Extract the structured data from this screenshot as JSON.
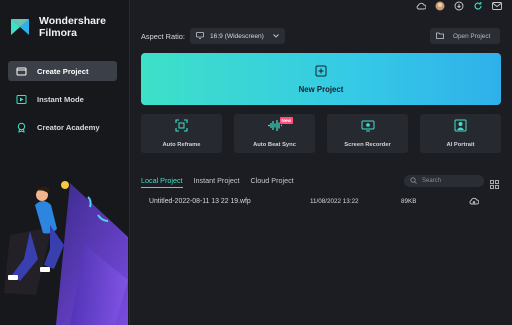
{
  "app": {
    "brand_line1": "Wondershare",
    "brand_line2": "Filmora"
  },
  "sidebar": {
    "items": [
      {
        "label": "Create Project",
        "icon": "folder-icon",
        "active": true
      },
      {
        "label": "Instant Mode",
        "icon": "instant-mode-icon",
        "active": false
      },
      {
        "label": "Creator Academy",
        "icon": "academy-icon",
        "active": false
      }
    ]
  },
  "topbar": {
    "icons": [
      "cloud-icon",
      "user-avatar-icon",
      "download-icon",
      "sync-icon",
      "mail-icon"
    ]
  },
  "aspect": {
    "label": "Aspect Ratio:",
    "value": "16:9 (Widescreen)"
  },
  "open_project": {
    "label": "Open Project"
  },
  "new_project": {
    "label": "New Project"
  },
  "tools": [
    {
      "label": "Auto Reframe",
      "icon": "auto-reframe-icon"
    },
    {
      "label": "Auto Beat Sync",
      "icon": "beat-sync-icon",
      "badge": "New"
    },
    {
      "label": "Screen Recorder",
      "icon": "screen-recorder-icon"
    },
    {
      "label": "AI Portrait",
      "icon": "ai-portrait-icon"
    }
  ],
  "tabs": [
    "Local Project",
    "Instant Project",
    "Cloud Project"
  ],
  "search": {
    "placeholder": "Search"
  },
  "projects": [
    {
      "name": "Untitled-2022-08-11 13 22 19.wfp",
      "date": "11/08/2022 13:22",
      "size": "89KB"
    }
  ],
  "colors": {
    "accent": "#3ee0c8",
    "new_badge": "#ff4f7a",
    "background": "#1b1d22"
  }
}
